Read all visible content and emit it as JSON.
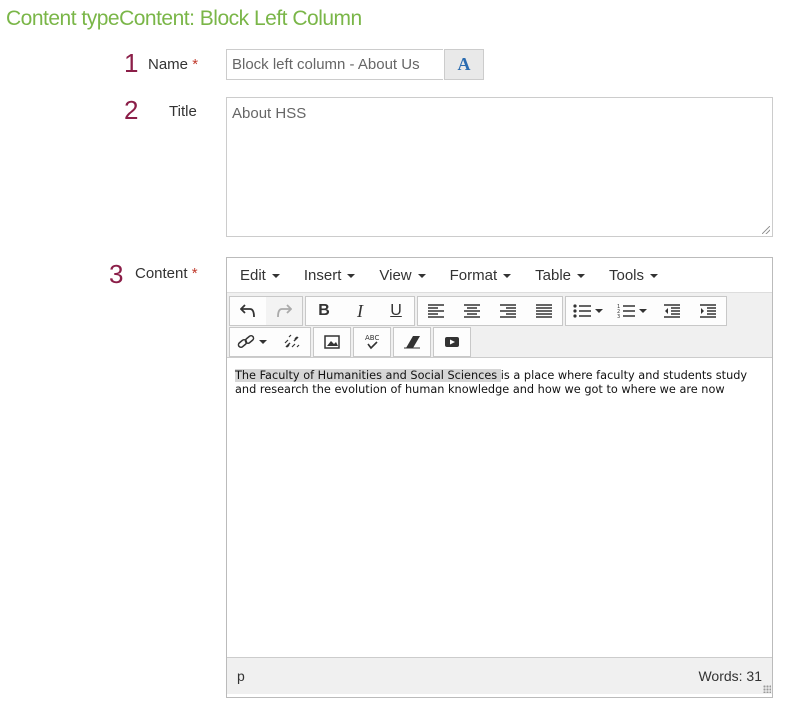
{
  "page": {
    "title": "Content typeContent: Block Left Column"
  },
  "fields": {
    "name": {
      "step": "1",
      "label": "Name",
      "required": "*",
      "value": "Block left column - About Us",
      "lang_button": "A"
    },
    "title": {
      "step": "2",
      "label": "Title",
      "value": "About HSS"
    },
    "content": {
      "step": "3",
      "label": "Content",
      "required": "*"
    }
  },
  "editor": {
    "menus": [
      {
        "label": "Edit"
      },
      {
        "label": "Insert"
      },
      {
        "label": "View"
      },
      {
        "label": "Format"
      },
      {
        "label": "Table"
      },
      {
        "label": "Tools"
      }
    ],
    "toolbar_icons": [
      "undo-icon",
      "redo-icon",
      "bold-icon",
      "italic-icon",
      "underline-icon",
      "align-left-icon",
      "align-center-icon",
      "align-right-icon",
      "align-justify-icon",
      "bullet-list-icon",
      "numbered-list-icon",
      "outdent-icon",
      "indent-icon",
      "link-icon",
      "unlink-icon",
      "image-icon",
      "spellcheck-icon",
      "clear-formatting-icon",
      "media-icon"
    ],
    "body": {
      "highlighted": "The Faculty of Humanities and Social Sciences ",
      "rest": "is a place where faculty and students study and research the evolution of human knowledge and how we got to where we are now"
    },
    "status": {
      "path": "p",
      "words": "Words: 31"
    }
  },
  "colors": {
    "title": "#7ab648",
    "step": "#8b1e48",
    "required": "#c0392b"
  }
}
